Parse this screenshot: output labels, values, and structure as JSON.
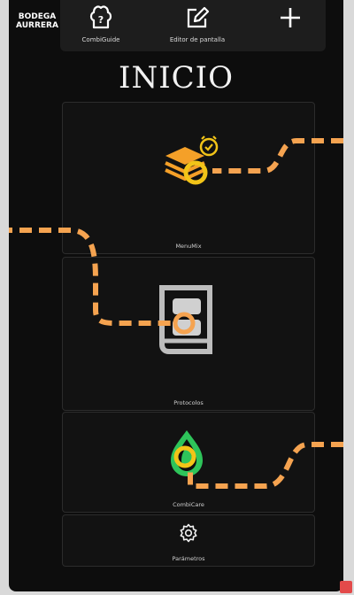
{
  "brand": {
    "line1": "BODEGA",
    "line2": "AURRERA"
  },
  "toolbar": {
    "combiguide_label": "CombiGuide",
    "editor_label": "Editor de pantalla"
  },
  "page": {
    "title": "INICIO"
  },
  "cards": {
    "menumix": "MenuMix",
    "protocolos": "Protocolos",
    "combicare": "CombiCare",
    "parametros": "Parámetros"
  },
  "colors": {
    "accent_orange": "#f5a350",
    "accent_yellow": "#f2c418",
    "accent_green": "#2ec45a",
    "background": "#0d0d0d"
  }
}
